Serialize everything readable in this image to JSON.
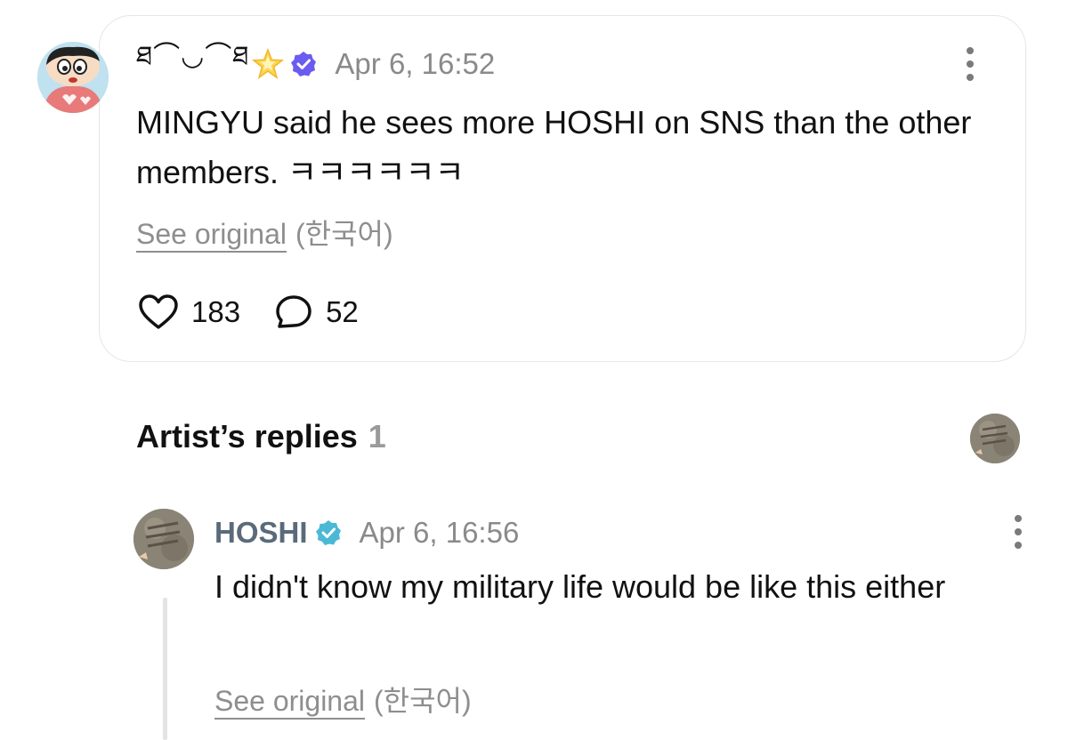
{
  "post": {
    "author": "ཐ⌒◡⌒ཐ",
    "timestamp": "Apr 6, 16:52",
    "text": "MINGYU said he sees more HOSHI on SNS than the other members. ㅋㅋㅋㅋㅋㅋ",
    "see_original": "See original",
    "language": "(한국어)",
    "likes": "183",
    "comments": "52"
  },
  "artist_replies": {
    "title": "Artist’s replies",
    "count": "1"
  },
  "reply": {
    "author": "HOSHI",
    "timestamp": "Apr 6, 16:56",
    "text": "I didn't know my military life would be like this either",
    "see_original": "See original",
    "language": "(한국어)"
  },
  "colors": {
    "verified_fan": "#6b5cf0",
    "verified_artist": "#4bb8d6",
    "muted": "#8a8a8a",
    "artist_name": "#5a6a7a"
  },
  "icons": [
    "star-icon",
    "verified-badge-icon",
    "more-options-icon",
    "heart-icon",
    "comment-bubble-icon"
  ]
}
